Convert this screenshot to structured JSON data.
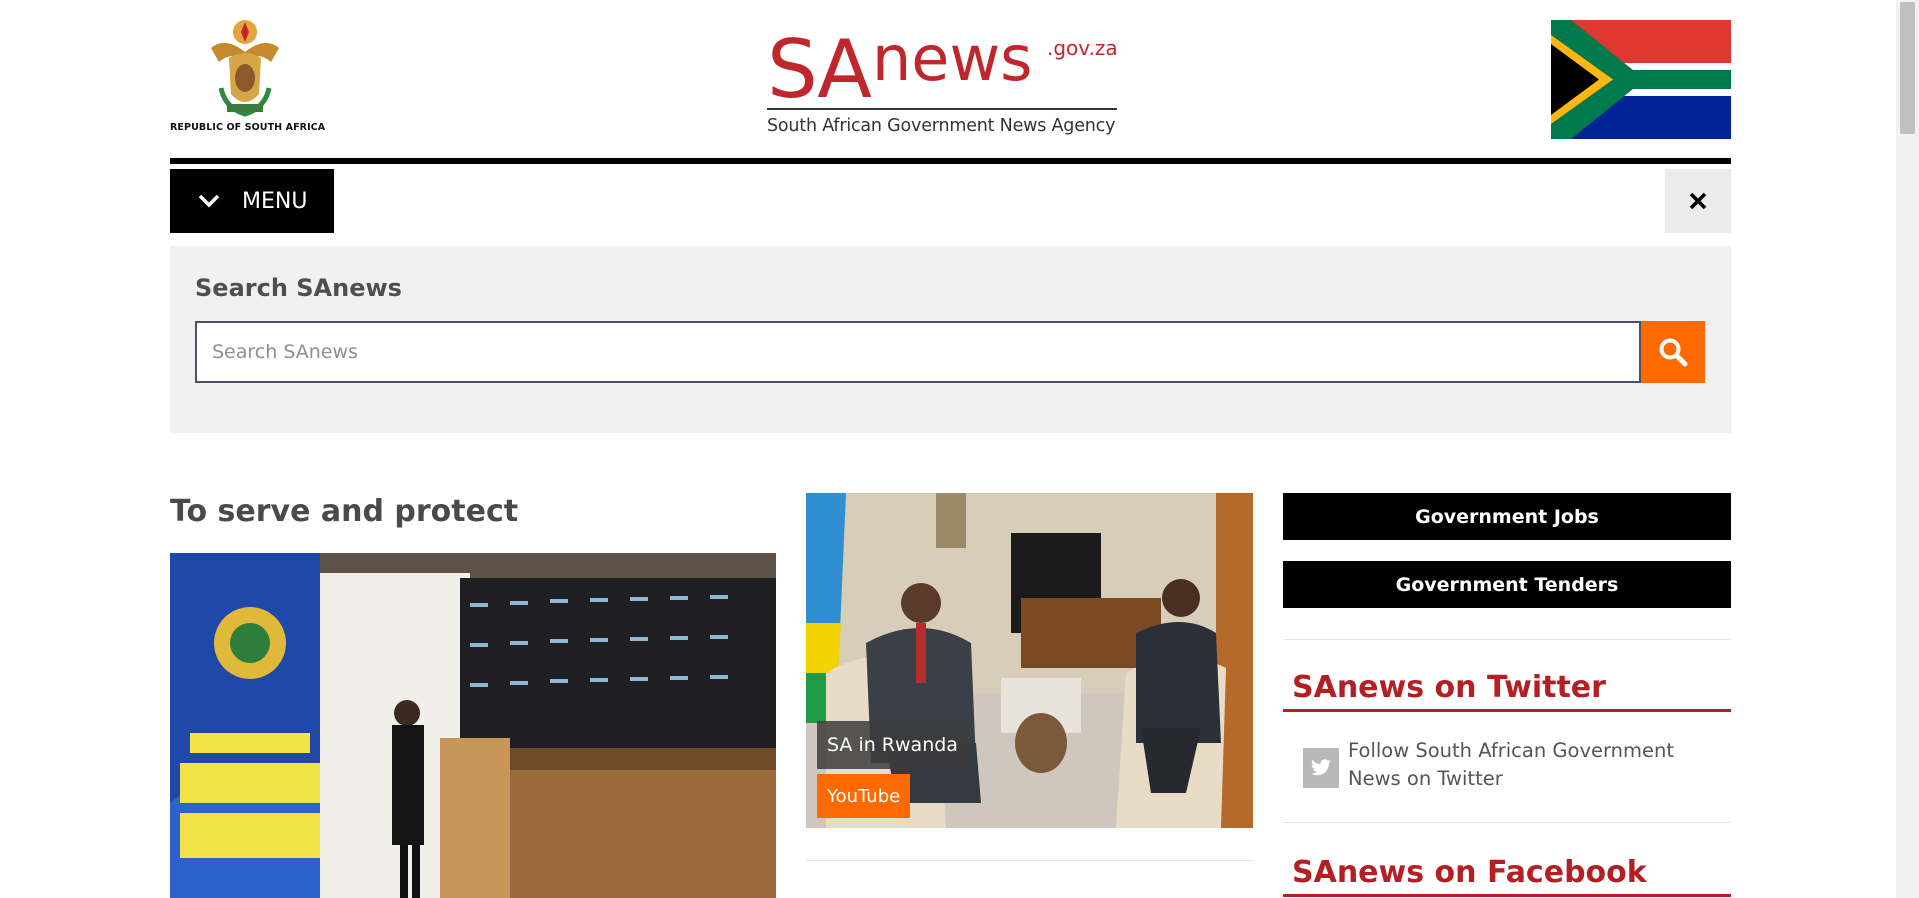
{
  "header": {
    "coat_caption": "REPUBLIC OF SOUTH AFRICA",
    "logo_sa": "SA",
    "logo_news": "news",
    "logo_domain": ".gov.za",
    "logo_tagline": "South African Government News Agency"
  },
  "nav": {
    "menu_label": "MENU",
    "menu_icon": "chevron-down-icon",
    "close_icon": "close-icon"
  },
  "search": {
    "title": "Search SAnews",
    "placeholder": "Search SAnews",
    "value": "",
    "button_icon": "search-icon"
  },
  "main": {
    "headline": "To serve and protect",
    "feature_caption": "SA in Rwanda",
    "feature_source": "YouTube"
  },
  "sidebar": {
    "buttons": [
      "Government Jobs",
      "Government Tenders"
    ],
    "twitter_heading": "SAnews on Twitter",
    "twitter_follow": "Follow South African Government News on Twitter",
    "twitter_icon": "twitter-icon",
    "facebook_heading": "SAnews on Facebook"
  },
  "colors": {
    "brand_red": "#c0272d",
    "accent_orange": "#ff6a00",
    "heading_red": "#b41f24",
    "panel_gray": "#f1f1f1"
  }
}
